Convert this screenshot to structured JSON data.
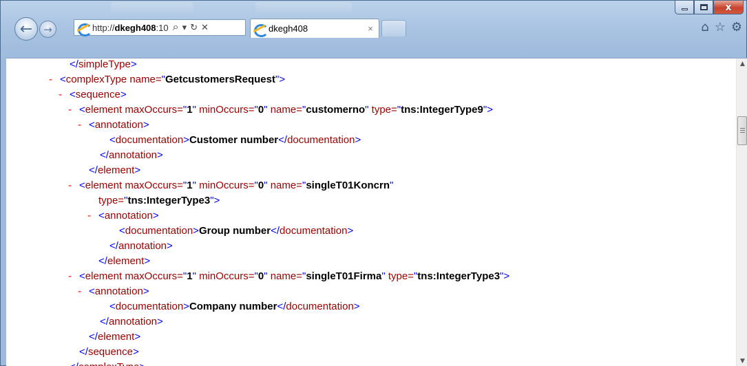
{
  "window": {
    "title_tab_ghost_1": "",
    "title_tab_ghost_2": "",
    "close_label": "x"
  },
  "address_bar": {
    "url_scheme": "http://",
    "url_host": "dkegh408",
    "url_rest": ":10",
    "search_glyph": "⌕",
    "dropdown_glyph": "▾",
    "refresh_glyph": "↻",
    "stop_glyph": "✕"
  },
  "tab": {
    "label": "dkegh408",
    "close_glyph": "×"
  },
  "toolbar_icons": {
    "home": "⌂",
    "favorites": "☆",
    "tools": "⚙"
  },
  "xml_lines": [
    {
      "indent": 92,
      "minus": "",
      "parts": [
        [
          "ang",
          "</"
        ],
        [
          "tag",
          "simpleType"
        ],
        [
          "ang",
          ">"
        ]
      ]
    },
    {
      "indent": 78,
      "minus": "-",
      "parts": [
        [
          "ang",
          "<"
        ],
        [
          "tag",
          "complexType "
        ],
        [
          "tag",
          "name="
        ],
        [
          "ang",
          "\""
        ],
        [
          "val",
          "GetcustomersRequest"
        ],
        [
          "ang",
          "\""
        ],
        [
          "ang",
          ">"
        ]
      ]
    },
    {
      "indent": 92,
      "minus": "-",
      "parts": [
        [
          "ang",
          "<"
        ],
        [
          "tag",
          "sequence"
        ],
        [
          "ang",
          ">"
        ]
      ]
    },
    {
      "indent": 106,
      "minus": "-",
      "parts": [
        [
          "ang",
          "<"
        ],
        [
          "tag",
          "element "
        ],
        [
          "tag",
          "maxOccurs="
        ],
        [
          "ang",
          "\""
        ],
        [
          "val",
          "1"
        ],
        [
          "ang",
          "\""
        ],
        [
          "tag",
          " minOccurs="
        ],
        [
          "ang",
          "\""
        ],
        [
          "val",
          "0"
        ],
        [
          "ang",
          "\""
        ],
        [
          "tag",
          " name="
        ],
        [
          "ang",
          "\""
        ],
        [
          "val",
          "customerno"
        ],
        [
          "ang",
          "\""
        ],
        [
          "tag",
          " type="
        ],
        [
          "ang",
          "\""
        ],
        [
          "val",
          "tns:IntegerType9"
        ],
        [
          "ang",
          "\""
        ],
        [
          "ang",
          ">"
        ]
      ]
    },
    {
      "indent": 120,
      "minus": "-",
      "parts": [
        [
          "ang",
          "<"
        ],
        [
          "tag",
          "annotation"
        ],
        [
          "ang",
          ">"
        ]
      ]
    },
    {
      "indent": 150,
      "minus": "",
      "parts": [
        [
          "ang",
          "<"
        ],
        [
          "tag",
          "documentation"
        ],
        [
          "ang",
          ">"
        ],
        [
          "txt",
          "Customer number"
        ],
        [
          "ang",
          "</"
        ],
        [
          "tag",
          "documentation"
        ],
        [
          "ang",
          ">"
        ]
      ]
    },
    {
      "indent": 136,
      "minus": "",
      "parts": [
        [
          "ang",
          "</"
        ],
        [
          "tag",
          "annotation"
        ],
        [
          "ang",
          ">"
        ]
      ]
    },
    {
      "indent": 120,
      "minus": "",
      "parts": [
        [
          "ang",
          "</"
        ],
        [
          "tag",
          "element"
        ],
        [
          "ang",
          ">"
        ]
      ]
    },
    {
      "indent": 106,
      "minus": "-",
      "parts": [
        [
          "ang",
          "<"
        ],
        [
          "tag",
          "element "
        ],
        [
          "tag",
          "maxOccurs="
        ],
        [
          "ang",
          "\""
        ],
        [
          "val",
          "1"
        ],
        [
          "ang",
          "\""
        ],
        [
          "tag",
          " minOccurs="
        ],
        [
          "ang",
          "\""
        ],
        [
          "val",
          "0"
        ],
        [
          "ang",
          "\""
        ],
        [
          "tag",
          " name="
        ],
        [
          "ang",
          "\""
        ],
        [
          "val",
          "singleT01Koncrn"
        ],
        [
          "ang",
          "\""
        ]
      ]
    },
    {
      "indent": 134,
      "minus": "",
      "parts": [
        [
          "tag",
          "type="
        ],
        [
          "ang",
          "\""
        ],
        [
          "val",
          "tns:IntegerType3"
        ],
        [
          "ang",
          "\""
        ],
        [
          "ang",
          ">"
        ]
      ]
    },
    {
      "indent": 134,
      "minus": "-",
      "parts": [
        [
          "ang",
          "<"
        ],
        [
          "tag",
          "annotation"
        ],
        [
          "ang",
          ">"
        ]
      ]
    },
    {
      "indent": 164,
      "minus": "",
      "parts": [
        [
          "ang",
          "<"
        ],
        [
          "tag",
          "documentation"
        ],
        [
          "ang",
          ">"
        ],
        [
          "txt",
          "Group number"
        ],
        [
          "ang",
          "</"
        ],
        [
          "tag",
          "documentation"
        ],
        [
          "ang",
          ">"
        ]
      ]
    },
    {
      "indent": 150,
      "minus": "",
      "parts": [
        [
          "ang",
          "</"
        ],
        [
          "tag",
          "annotation"
        ],
        [
          "ang",
          ">"
        ]
      ]
    },
    {
      "indent": 134,
      "minus": "",
      "parts": [
        [
          "ang",
          "</"
        ],
        [
          "tag",
          "element"
        ],
        [
          "ang",
          ">"
        ]
      ]
    },
    {
      "indent": 106,
      "minus": "-",
      "parts": [
        [
          "ang",
          "<"
        ],
        [
          "tag",
          "element "
        ],
        [
          "tag",
          "maxOccurs="
        ],
        [
          "ang",
          "\""
        ],
        [
          "val",
          "1"
        ],
        [
          "ang",
          "\""
        ],
        [
          "tag",
          " minOccurs="
        ],
        [
          "ang",
          "\""
        ],
        [
          "val",
          "0"
        ],
        [
          "ang",
          "\""
        ],
        [
          "tag",
          " name="
        ],
        [
          "ang",
          "\""
        ],
        [
          "val",
          "singleT01Firma"
        ],
        [
          "ang",
          "\""
        ],
        [
          "tag",
          " type="
        ],
        [
          "ang",
          "\""
        ],
        [
          "val",
          "tns:IntegerType3"
        ],
        [
          "ang",
          "\""
        ],
        [
          "ang",
          ">"
        ]
      ]
    },
    {
      "indent": 120,
      "minus": "-",
      "parts": [
        [
          "ang",
          "<"
        ],
        [
          "tag",
          "annotation"
        ],
        [
          "ang",
          ">"
        ]
      ]
    },
    {
      "indent": 150,
      "minus": "",
      "parts": [
        [
          "ang",
          "<"
        ],
        [
          "tag",
          "documentation"
        ],
        [
          "ang",
          ">"
        ],
        [
          "txt",
          "Company number"
        ],
        [
          "ang",
          "</"
        ],
        [
          "tag",
          "documentation"
        ],
        [
          "ang",
          ">"
        ]
      ]
    },
    {
      "indent": 136,
      "minus": "",
      "parts": [
        [
          "ang",
          "</"
        ],
        [
          "tag",
          "annotation"
        ],
        [
          "ang",
          ">"
        ]
      ]
    },
    {
      "indent": 120,
      "minus": "",
      "parts": [
        [
          "ang",
          "</"
        ],
        [
          "tag",
          "element"
        ],
        [
          "ang",
          ">"
        ]
      ]
    },
    {
      "indent": 106,
      "minus": "",
      "parts": [
        [
          "ang",
          "</"
        ],
        [
          "tag",
          "sequence"
        ],
        [
          "ang",
          ">"
        ]
      ]
    },
    {
      "indent": 92,
      "minus": "",
      "parts": [
        [
          "ang",
          "</"
        ],
        [
          "tag",
          "complexType"
        ],
        [
          "ang",
          ">"
        ]
      ]
    }
  ],
  "scrollbar": {
    "up_glyph": "▲",
    "down_glyph": "▼",
    "position_fraction": 0.18
  }
}
